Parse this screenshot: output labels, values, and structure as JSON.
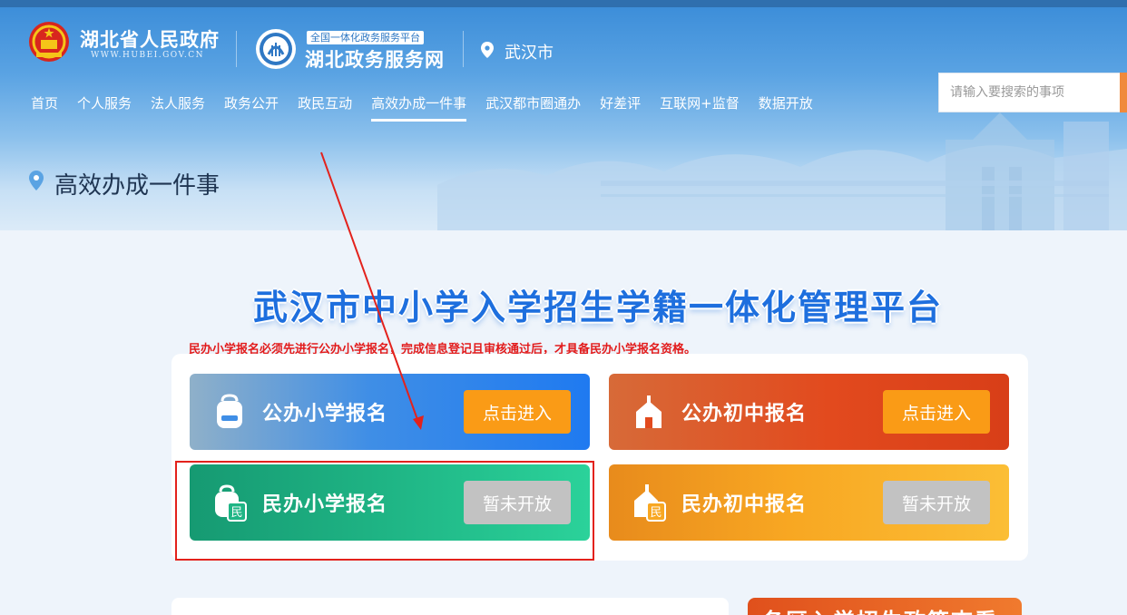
{
  "header": {
    "gov_title": "湖北省人民政府",
    "gov_url": "WWW.HUBEI.GOV.CN",
    "svc_badge": "全国一体化政务服务平台",
    "svc_name": "湖北政务服务网",
    "location": "武汉市",
    "nav": [
      {
        "label": "首页",
        "active": false
      },
      {
        "label": "个人服务",
        "active": false
      },
      {
        "label": "法人服务",
        "active": false
      },
      {
        "label": "政务公开",
        "active": false
      },
      {
        "label": "政民互动",
        "active": false
      },
      {
        "label": "高效办成一件事",
        "active": true
      },
      {
        "label": "武汉都市圈通办",
        "active": false
      },
      {
        "label": "好差评",
        "active": false
      },
      {
        "label": "互联网+监督",
        "active": false
      },
      {
        "label": "数据开放",
        "active": false
      }
    ],
    "search_placeholder": "请输入要搜索的事项"
  },
  "page": {
    "title": "高效办成一件事"
  },
  "main": {
    "platform_title": "武汉市中小学入学招生学籍一体化管理平台",
    "notice": "民办小学报名必须先进行公办小学报名，完成信息登记且审核通过后，才具备民办小学报名资格。",
    "cards": [
      {
        "label": "公办小学报名",
        "button": "点击进入",
        "status": "open",
        "icon": "backpack-icon"
      },
      {
        "label": "公办初中报名",
        "button": "点击进入",
        "status": "open",
        "icon": "school-building-icon"
      },
      {
        "label": "民办小学报名",
        "button": "暂未开放",
        "status": "closed",
        "icon": "backpack-min-icon"
      },
      {
        "label": "民办初中报名",
        "button": "暂未开放",
        "status": "closed",
        "icon": "school-building-min-icon"
      }
    ],
    "bottom_right_title": "各区入学招生政策查看"
  },
  "colors": {
    "brand_blue": "#1e6fde",
    "open_button": "#fa9b16",
    "closed_button": "#c2c2c2",
    "annotation_red": "#e3221c"
  }
}
